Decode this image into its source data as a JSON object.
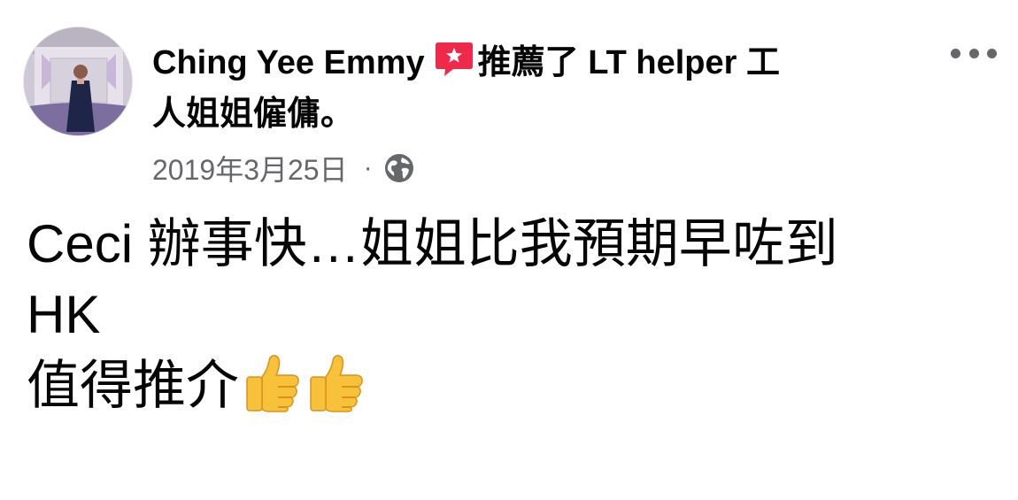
{
  "post": {
    "author": "Ching Yee Emmy",
    "action_text": "推薦了 LT helper工人姐姐僱傭。",
    "action_line1": "推薦了 LT helper 工",
    "action_line2": "人姐姐僱傭。",
    "date": "2019年3月25日",
    "separator": "·",
    "privacy_icon": "globe-icon",
    "recommend_icon": "recommendation-star-icon",
    "body_lines": [
      "Ceci 辦事快…姐姐比我預期早咗到",
      "HK",
      "值得推介"
    ],
    "emoji": [
      "👍",
      "👍"
    ],
    "more_icon": "more-options-icon"
  },
  "colors": {
    "text": "#050505",
    "secondary_text": "#65676b",
    "recommend_badge": "#f0284a"
  }
}
